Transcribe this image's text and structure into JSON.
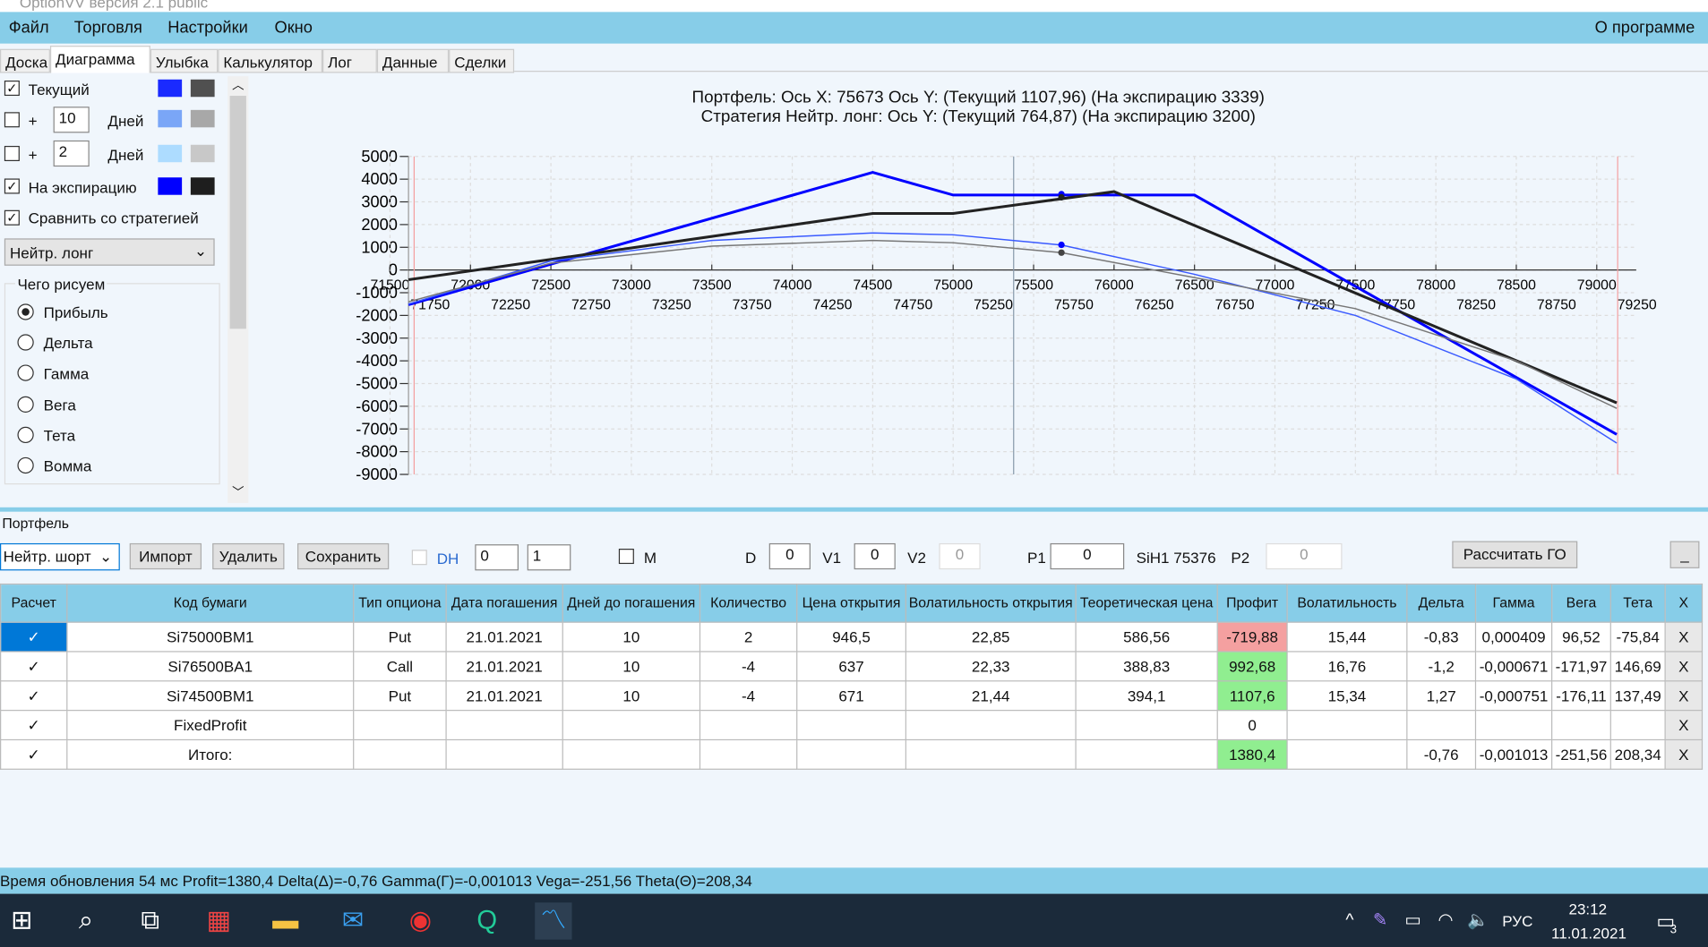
{
  "window": {
    "title": "OptionVV версия 2.1 public"
  },
  "menu": {
    "items": [
      "Файл",
      "Торговля",
      "Настройки",
      "Окно"
    ],
    "about": "О программе"
  },
  "tabs": [
    "Доска",
    "Диаграмма",
    "Улыбка",
    "Калькулятор",
    "Лог",
    "Данные",
    "Сделки"
  ],
  "left": {
    "current": {
      "label": "Текущий",
      "checked": true,
      "colors": [
        "#1a2aff",
        "#505050"
      ]
    },
    "plus1": {
      "plus": "+",
      "value": "10",
      "unit": "Дней",
      "checked": false,
      "colors": [
        "#7aa6f7",
        "#a8a8a8"
      ]
    },
    "plus2": {
      "plus": "+",
      "value": "2",
      "unit": "Дней",
      "checked": false,
      "colors": [
        "#addcff",
        "#c8c8c8"
      ]
    },
    "expiration": {
      "label": "На экспирацию",
      "checked": true,
      "colors": [
        "#0000ff",
        "#1e1e1e"
      ]
    },
    "compare": {
      "label": "Сравнить со стратегией",
      "checked": true
    },
    "strategy_select": "Нейтр. лонг",
    "draw_group": "Чего рисуем",
    "draw_options": [
      "Прибыль",
      "Дельта",
      "Гамма",
      "Вега",
      "Тета",
      "Вомма"
    ],
    "draw_selected": "Прибыль"
  },
  "chart_header": {
    "line1": "Портфель: Ось X: 75673 Ось Y:  (Текущий 1107,96)  (На экспирацию 3339)",
    "line2": "Стратегия Нейтр. лонг:  Ось Y:  (Текущий 764,87)  (На экспирацию 3200)"
  },
  "chart_data": {
    "type": "line",
    "xlim": [
      71500,
      79250
    ],
    "ylim": [
      -9000,
      5000
    ],
    "y_ticks": [
      5000,
      4000,
      3000,
      2000,
      1000,
      0,
      -1000,
      -2000,
      -3000,
      -4000,
      -5000,
      -6000,
      -7000,
      -8000,
      -9000
    ],
    "x_ticks_top": [
      71500,
      72000,
      72500,
      73000,
      73500,
      74000,
      74500,
      75000,
      75500,
      76000,
      76500,
      77000,
      77500,
      78000,
      78500,
      79000
    ],
    "x_ticks_bottom": [
      71750,
      72250,
      72750,
      73250,
      73750,
      74250,
      74750,
      75250,
      75750,
      76250,
      76750,
      77250,
      77750,
      78250,
      78750,
      79250
    ],
    "grid": true,
    "cursor_x": 75673,
    "price_line_x": 75376,
    "range_lines": [
      71650,
      79130
    ],
    "series": [
      {
        "color": "#0000ff",
        "width": 2.5,
        "x": [
          71615,
          74500,
          75000,
          76500,
          79124
        ],
        "y": [
          -1530,
          4300,
          3300,
          3300,
          -7240
        ]
      },
      {
        "color": "#222222",
        "width": 2.5,
        "x": [
          71615,
          74500,
          75000,
          76000,
          79124
        ],
        "y": [
          -430,
          2490,
          2490,
          3450,
          -5850
        ]
      },
      {
        "color": "#3a5aff",
        "width": 1.2,
        "x": [
          71615,
          72500,
          73500,
          74500,
          75000,
          75673,
          76500,
          77500,
          78500,
          79124
        ],
        "y": [
          -1500,
          400,
          1300,
          1630,
          1550,
          1100,
          -190,
          -2000,
          -4800,
          -7620
        ]
      },
      {
        "color": "#777777",
        "width": 1.2,
        "x": [
          71615,
          72500,
          73500,
          74500,
          75000,
          75673,
          76500,
          77500,
          78500,
          79124
        ],
        "y": [
          -1400,
          300,
          1050,
          1300,
          1200,
          765,
          -335,
          -1700,
          -4000,
          -6090
        ]
      }
    ],
    "markers": [
      {
        "x": 75673,
        "y": 3339,
        "color": "#0000ff"
      },
      {
        "x": 75673,
        "y": 3200,
        "color": "#222"
      },
      {
        "x": 75673,
        "y": 1108,
        "color": "#0000ff"
      },
      {
        "x": 75673,
        "y": 765,
        "color": "#444"
      }
    ]
  },
  "portfolio": {
    "group": "Портфель",
    "select": "Нейтр. шорт",
    "import": "Импорт",
    "delete": "Удалить",
    "save": "Сохранить",
    "dh": "DH",
    "spin1": "0",
    "spin2": "1",
    "m": "M",
    "d_label": "D",
    "d": "0",
    "v1_label": "V1",
    "v1": "0",
    "v2_label": "V2",
    "v2": "0",
    "p1_label": "P1",
    "p1": "0",
    "sih1": "SiH1 75376",
    "p2_label": "P2",
    "p2": "0",
    "calc_go": "Рассчитать ГО",
    "minimize": "_"
  },
  "table": {
    "headers": [
      "Расчет",
      "Код бумаги",
      "Тип опциона",
      "Дата погашения",
      "Дней до погашения",
      "Количество",
      "Цена открытия",
      "Волатильность открытия",
      "Теоретическая цена",
      "Профит",
      "Волатильность",
      "Дельта",
      "Гамма",
      "Вега",
      "Тета",
      "X"
    ],
    "rows": [
      [
        "✓",
        "Si75000BM1",
        "Put",
        "21.01.2021",
        "10",
        "2",
        "946,5",
        "22,85",
        "586,56",
        "-719,88",
        "15,44",
        "-0,83",
        "0,000409",
        "96,52",
        "-75,84",
        "X"
      ],
      [
        "✓",
        "Si76500BA1",
        "Call",
        "21.01.2021",
        "10",
        "-4",
        "637",
        "22,33",
        "388,83",
        "992,68",
        "16,76",
        "-1,2",
        "-0,000671",
        "-171,97",
        "146,69",
        "X"
      ],
      [
        "✓",
        "Si74500BM1",
        "Put",
        "21.01.2021",
        "10",
        "-4",
        "671",
        "21,44",
        "394,1",
        "1107,6",
        "15,34",
        "1,27",
        "-0,000751",
        "-176,11",
        "137,49",
        "X"
      ],
      [
        "✓",
        "FixedProfit",
        "",
        "",
        "",
        "",
        "",
        "",
        "",
        "0",
        "",
        "",
        "",
        "",
        "",
        "X"
      ],
      [
        "✓",
        "Итого:",
        "",
        "",
        "",
        "",
        "",
        "",
        "",
        "1380,4",
        "",
        "-0,76",
        "-0,001013",
        "-251,56",
        "208,34",
        "X"
      ]
    ]
  },
  "status": "Время обновления 54 мс  Profit=1380,4 Delta(Δ)=-0,76 Gamma(Γ)=-0,001013 Vega=-251,56 Theta(Θ)=208,34",
  "taskbar": {
    "lang": "РУС",
    "time": "23:12",
    "date": "11.01.2021",
    "notifications": "3"
  }
}
